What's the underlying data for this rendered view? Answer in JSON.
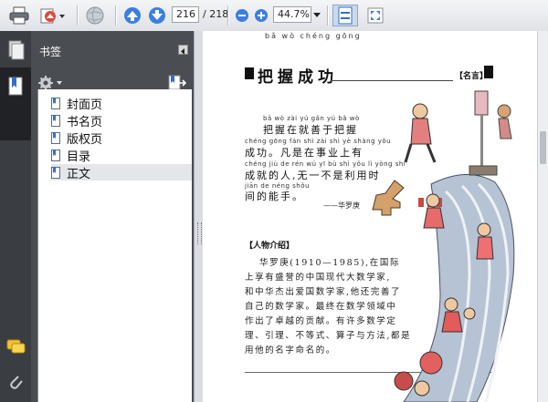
{
  "toolbar": {
    "page_number": "216",
    "page_total": "/ 218",
    "zoom": "44.7%"
  },
  "bookmarks_panel": {
    "title": "书签",
    "items": [
      {
        "label": "封面页"
      },
      {
        "label": "书名页"
      },
      {
        "label": "版权页"
      },
      {
        "label": "目录"
      },
      {
        "label": "正文"
      }
    ],
    "selected_index": 4
  },
  "document": {
    "title_pinyin": "bǎ   wò  chéng gōng",
    "title": "把握成功",
    "tag": "【名言】",
    "quote_pinyin": [
      "bǎ wò zài yú gǎn yú bǎ wò",
      "chéng gōng   fán shì zài shì yè shàng yǒu",
      "chéng jiù de rén  wú yī bù shì yǒu lì yòng shí",
      "jiān de néng shǒu"
    ],
    "quote_lines": [
      "把握在就善于把握",
      "成功。凡是在事业上有",
      "成就的人,无一不是利用时",
      "间的能手。"
    ],
    "attribution": "——华罗庚",
    "bio_heading": "【人物介绍】",
    "bio_lines": [
      "华罗庚(1910—1985),在国际",
      "上享有盛誉的中国现代大数学家,",
      "和中华杰出爱国数学家,他还完善了",
      "自己的数学家。最终在数学领域中",
      "作出了卓越的贡献。有许多数学定",
      "理、引理、不等式、算子与方法,都是",
      "用他的名字命名的。"
    ]
  },
  "colors": {
    "toolbar_bg": "#e6e8ec",
    "rail_bg": "#3a3d42",
    "panel_bg": "#4a4d52",
    "accent_blue": "#2f6fd0"
  }
}
